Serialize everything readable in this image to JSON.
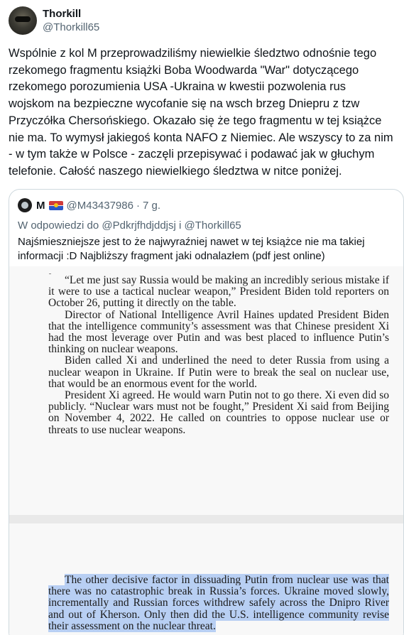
{
  "author": {
    "display_name": "Thorkill",
    "handle": "@Thorkill65"
  },
  "tweet": {
    "text_lines": [
      "Wspólnie z kol M przeprowadziliśmy niewielkie śledztwo odnośnie tego",
      "rzekomego fragmentu książki Boba Woodwarda \"War\" dotyczącego",
      "rzekomego porozumienia USA -Ukraina w kwestii pozwolenia rus",
      "wojskom na bezpieczne wycofanie się na wsch brzeg Dniepru z tzw",
      "Przyczółka Chersońskiego. Okazało się że tego fragmentu w tej książce",
      "nie ma. To wymysł jakiegoś konta NAFO z Niemiec. Ale wszyscy to za nim",
      "- w tym także w Polsce - zaczęli przepisywać i podawać jak w głuchym",
      "telefonie. Całość naszego niewielkiego śledztwa w nitce poniżej."
    ]
  },
  "quote": {
    "name": "M",
    "flag_icon": "kiribati-flag-icon",
    "handle": "@M43437986",
    "separator": "·",
    "time": "7 g.",
    "reply_prefix": "W odpowiedzi do ",
    "reply_to_1": "@Pdkrjfhdjddjsj",
    "reply_and": " i ",
    "reply_to_2": "@Thorkill65",
    "text_lines": [
      "Najśmieszniejsze jest to że najwyraźniej nawet w tej książce nie ma takiej",
      "informacji :D Najbliższy fragment jaki odnalazłem (pdf jest online)"
    ]
  },
  "document": {
    "page1_paragraphs": [
      "“Let me just say Russia would be making an incredibly serious mistake if it were to use a tactical nuclear weapon,” President Biden told reporters on October 26, putting it directly on the table.",
      "Director of National Intelligence Avril Haines updated President Biden that the intelligence community’s assessment was that Chinese president Xi had the most leverage over Putin and was best placed to influence Putin’s thinking on nuclear weapons.",
      "Biden called Xi and underlined the need to deter Russia from using a nuclear weapon in Ukraine. If Putin were to break the seal on nuclear use, that would be an enormous event for the world.",
      "President Xi agreed. He would warn Putin not to go there. Xi even did so publicly. “Nuclear wars must not be fought,” President Xi said from Beijing on November 4, 2022. He called on countries to oppose nuclear use or threats to use nuclear weapons."
    ],
    "page2_paragraph": "The other decisive factor in dissuading Putin from nuclear use was that there was no catastrophic break in Russia’s forces. Ukraine moved slowly, incrementally and Russian forces withdrew safely across the Dnipro River and out of Kherson. Only then did the U.S. intelligence community revise their assessment on the nuclear threat."
  }
}
